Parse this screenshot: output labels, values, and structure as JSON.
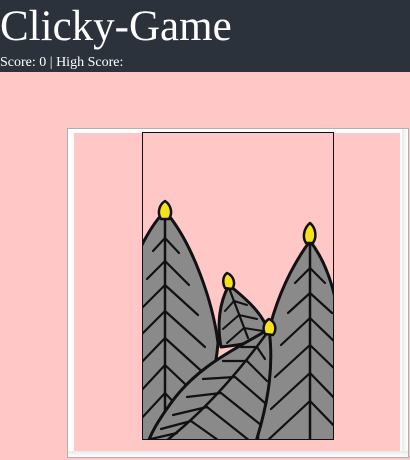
{
  "app": {
    "title": "Clicky-Game",
    "score_line": "Score: 0 | High Score:"
  },
  "colors": {
    "header_bg": "#2b323c",
    "page_bg": "#ffc7c6",
    "leaf_fill": "#8a8a8a",
    "tip_fill": "#f5e21c"
  },
  "board": {
    "cards": [
      {
        "icon": "leaves-icon"
      }
    ]
  }
}
